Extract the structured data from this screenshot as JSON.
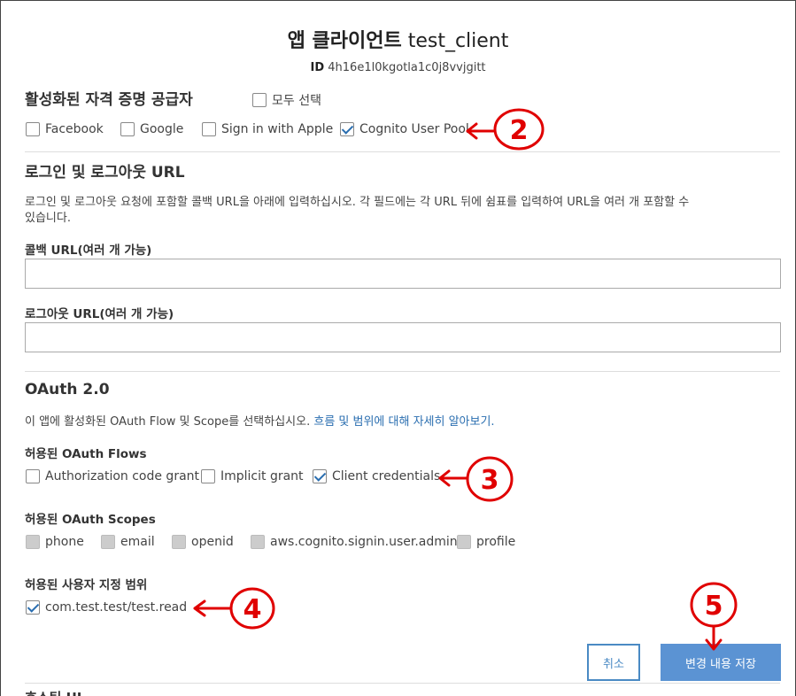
{
  "header": {
    "title_ko": "앱 클라이언트",
    "title_name": "test_client",
    "id_label": "ID",
    "id_value": "4h16e1l0kgotla1c0j8vvjgitt"
  },
  "providers": {
    "heading": "활성화된 자격 증명 공급자",
    "select_all": "모두 선택",
    "items": [
      {
        "label": "Facebook",
        "checked": false
      },
      {
        "label": "Google",
        "checked": false
      },
      {
        "label": "Sign in with Apple",
        "checked": false
      },
      {
        "label": "Cognito User Pool",
        "checked": true
      }
    ]
  },
  "urls": {
    "heading": "로그인 및 로그아웃 URL",
    "description_line1": "로그인 및 로그아웃 요청에 포함할 콜백 URL을 아래에 입력하십시오. 각 필드에는 각 URL 뒤에 쉼표를 입력하여 URL을 여러 개 포함할 수",
    "description_line2": "있습니다.",
    "callback_label": "콜백 URL(여러 개 가능)",
    "callback_value": "",
    "logout_label": "로그아웃 URL(여러 개 가능)",
    "logout_value": ""
  },
  "oauth": {
    "heading": "OAuth 2.0",
    "description": "이 앱에 활성화된 OAuth Flow 및 Scope를 선택하십시오.",
    "learn_more": "흐름 및 범위에 대해 자세히 알아보기.",
    "flows_label": "허용된 OAuth Flows",
    "flows": [
      {
        "label": "Authorization code grant",
        "checked": false
      },
      {
        "label": "Implicit grant",
        "checked": false
      },
      {
        "label": "Client credentials",
        "checked": true
      }
    ],
    "scopes_label": "허용된 OAuth Scopes",
    "scopes": [
      {
        "label": "phone",
        "disabled": true
      },
      {
        "label": "email",
        "disabled": true
      },
      {
        "label": "openid",
        "disabled": true
      },
      {
        "label": "aws.cognito.signin.user.admin",
        "disabled": true
      },
      {
        "label": "profile",
        "disabled": true
      }
    ],
    "custom_label": "허용된 사용자 지정 범위",
    "custom_scopes": [
      {
        "label": "com.test.test/test.read",
        "checked": true
      }
    ]
  },
  "actions": {
    "cancel": "취소",
    "save": "변경 내용 저장"
  },
  "next_section_heading": "호스팅 UI",
  "annotations": {
    "color": "#e00000",
    "marks": [
      "2",
      "3",
      "4",
      "5"
    ]
  }
}
